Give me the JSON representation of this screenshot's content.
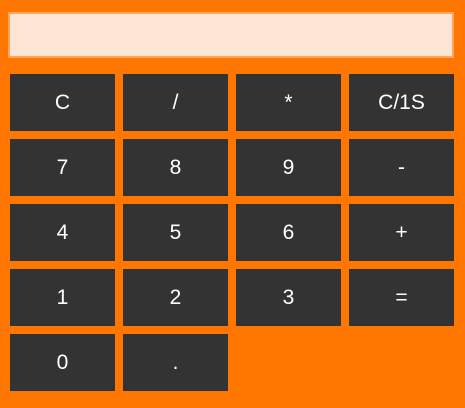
{
  "display": {
    "value": ""
  },
  "keys": {
    "clear": "C",
    "divide": "/",
    "multiply": "*",
    "clear_one": "C/1S",
    "seven": "7",
    "eight": "8",
    "nine": "9",
    "subtract": "-",
    "four": "4",
    "five": "5",
    "six": "6",
    "add": "+",
    "one": "1",
    "two": "2",
    "three": "3",
    "equals": "=",
    "zero": "0",
    "decimal": "."
  },
  "colors": {
    "background": "#ff7700",
    "display_bg": "#ffe5d5",
    "key_bg": "#333333",
    "key_text": "#ffffff"
  }
}
